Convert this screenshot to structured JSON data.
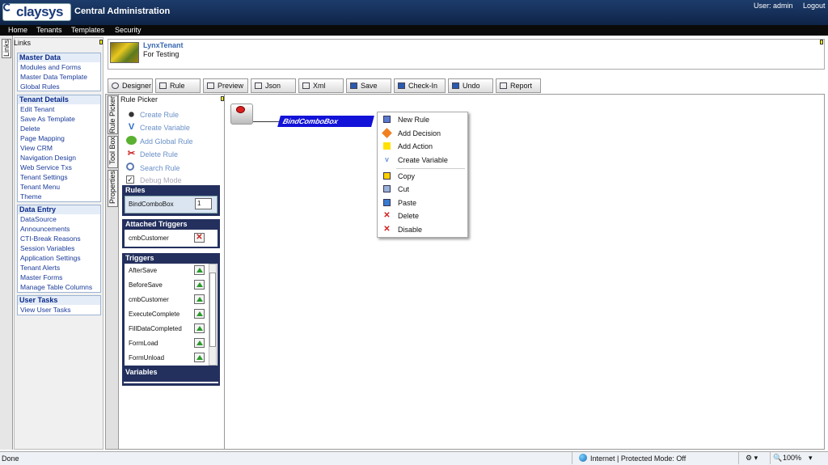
{
  "header": {
    "logo_text": "claysys",
    "title": "Central Administration",
    "user": "User: admin",
    "logout": "Logout"
  },
  "nav": [
    "Home",
    "Tenants",
    "Templates",
    "Security"
  ],
  "links_tab": "Links",
  "links_panel_title": "Links",
  "groups": [
    {
      "title": "Master Data",
      "items": [
        "Modules and Forms",
        "Master Data Template",
        "Global Rules"
      ]
    },
    {
      "title": "Tenant Details",
      "items": [
        "Edit Tenant",
        "Save As Template",
        "Delete",
        "Page Mapping",
        "View CRM",
        "Navigation Design",
        "Web Service Txs",
        "Tenant Settings",
        "Tenant Menu",
        "Theme"
      ]
    },
    {
      "title": "Data Entry",
      "items": [
        "DataSource",
        "Announcements",
        "CTI-Break Reasons",
        "Session Variables",
        "Application Settings",
        "Tenant Alerts",
        "Master Forms",
        "Manage Table Columns"
      ]
    },
    {
      "title": "User Tasks",
      "items": [
        "View User Tasks"
      ]
    }
  ],
  "tenant": {
    "name": "LynxTenant",
    "description": "For Testing"
  },
  "toolbar": [
    "Designer",
    "Rule",
    "Preview",
    "Json",
    "Xml",
    "Save",
    "Check-In",
    "Undo",
    "Report"
  ],
  "side_tabs": [
    "Rule Picker",
    "Tool Box",
    "Properties"
  ],
  "picker": {
    "title": "Rule Picker",
    "actions": [
      "Create Rule",
      "Create Variable",
      "Add Global Rule",
      "Delete Rule",
      "Search Rule",
      "Debug Mode"
    ],
    "rules_header": "Rules",
    "rule_name": "BindComboBox",
    "rule_value": "1",
    "attached_header": "Attached Triggers",
    "attached": [
      "cmbCustomer"
    ],
    "triggers_header": "Triggers",
    "triggers": [
      "AfterSave",
      "BeforeSave",
      "cmbCustomer",
      "ExecuteComplete",
      "FillDataCompleted",
      "FormLoad",
      "FormUnload"
    ],
    "variables_header": "Variables"
  },
  "canvas": {
    "node_label": "BindComboBox"
  },
  "context_menu": [
    "New Rule",
    "Add Decision",
    "Add Action",
    "Create Variable",
    "Copy",
    "Cut",
    "Paste",
    "Delete",
    "Disable"
  ],
  "status": {
    "left": "Done",
    "zone": "Internet | Protected Mode: Off",
    "zoom": "100%"
  }
}
